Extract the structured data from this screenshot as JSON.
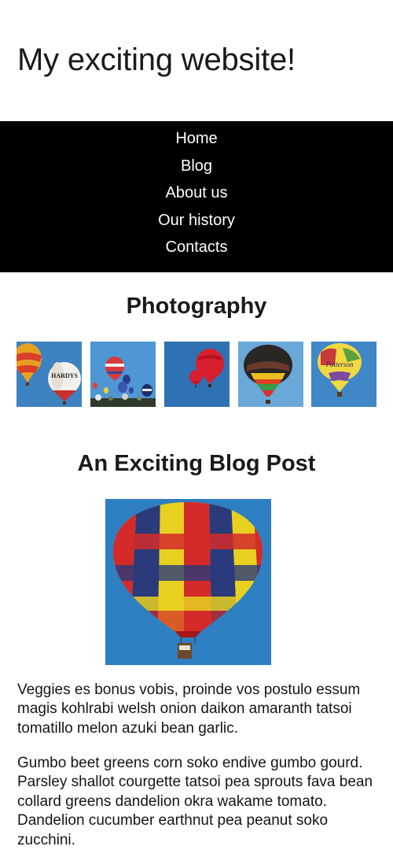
{
  "site": {
    "title": "My exciting website!"
  },
  "nav": {
    "items": [
      {
        "label": "Home"
      },
      {
        "label": "Blog"
      },
      {
        "label": "About us"
      },
      {
        "label": "Our history"
      },
      {
        "label": "Contacts"
      }
    ]
  },
  "photography": {
    "heading": "Photography",
    "thumbnails": [
      {
        "icon": "balloon-photo-icon"
      },
      {
        "icon": "balloon-photo-icon"
      },
      {
        "icon": "balloon-photo-icon"
      },
      {
        "icon": "balloon-photo-icon"
      },
      {
        "icon": "balloon-photo-icon"
      }
    ]
  },
  "blog_post": {
    "heading": "An Exciting Blog Post",
    "paragraphs": [
      "Veggies es bonus vobis, proinde vos postulo essum magis kohlrabi welsh onion daikon amaranth tatsoi tomatillo melon azuki bean garlic.",
      "Gumbo beet greens corn soko endive gumbo gourd. Parsley shallot courgette tatsoi pea sprouts fava bean collard greens dandelion okra wakame tomato. Dandelion cucumber earthnut pea peanut soko zucchini."
    ]
  },
  "colors": {
    "nav_background": "#000000",
    "nav_text": "#ffffff",
    "sky_blue": "#3f87c6"
  }
}
